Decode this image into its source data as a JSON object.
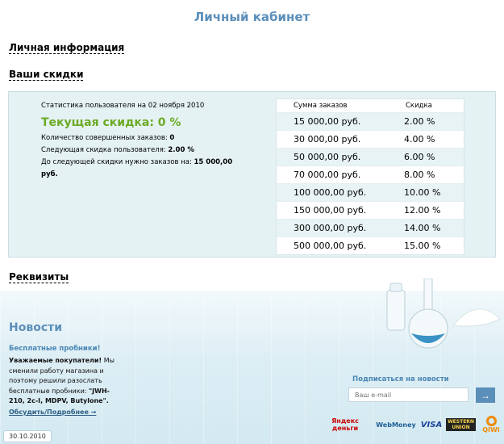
{
  "page": {
    "title": "Личный кабинет"
  },
  "sections": {
    "personal": "Личная информация",
    "discounts": "Ваши скидки",
    "requisites": "Реквизиты"
  },
  "stats": {
    "heading": "Статистика пользователя на 02 ноября 2010",
    "current_label": "Текущая скидка: 0 %",
    "orders_label": "Количество совершенных заказов:",
    "orders_value": "0",
    "next_label": "Следующая скидка пользователя:",
    "next_value": "2.00 %",
    "remaining_label": "До следующей скидки нужно заказов на:",
    "remaining_value": "15 000,00 руб."
  },
  "discount_table": {
    "headers": [
      "Сумма заказов",
      "Скидка"
    ],
    "rows": [
      [
        "15 000,00 руб.",
        "2.00 %"
      ],
      [
        "30 000,00 руб.",
        "4.00 %"
      ],
      [
        "50 000,00 руб.",
        "6.00 %"
      ],
      [
        "70 000,00 руб.",
        "8.00 %"
      ],
      [
        "100 000,00 руб.",
        "10.00 %"
      ],
      [
        "150 000,00 руб.",
        "12.00 %"
      ],
      [
        "300 000,00 руб.",
        "14.00 %"
      ],
      [
        "500 000,00 руб.",
        "15.00 %"
      ]
    ]
  },
  "news": {
    "title": "Новости",
    "headline": "Бесплатные пробники!",
    "body_bold": "Уважаемые покупатели!",
    "body_text": " Мы сменили работу магазина и поэтому решили разослать бесплатные пробники: ",
    "body_bold2": "\"JWH-210, 2c-I, MDPV, Butylone\".",
    "more_link": "Обсудить/Подробнее →",
    "date": "30.10.2010"
  },
  "subscribe": {
    "label": "Подписаться на новости",
    "placeholder": "Ваш e-mail",
    "submit_icon": "→"
  },
  "payments": {
    "yandex": "Яндекс деньги",
    "webmoney": "WebMoney",
    "visa": "VISA",
    "western_union": "WESTERN UNION",
    "qiwi": "QIWI"
  },
  "colors": {
    "accent": "#5b8fba",
    "discount_green": "#6cab24",
    "panel": "#e5f2f4"
  }
}
